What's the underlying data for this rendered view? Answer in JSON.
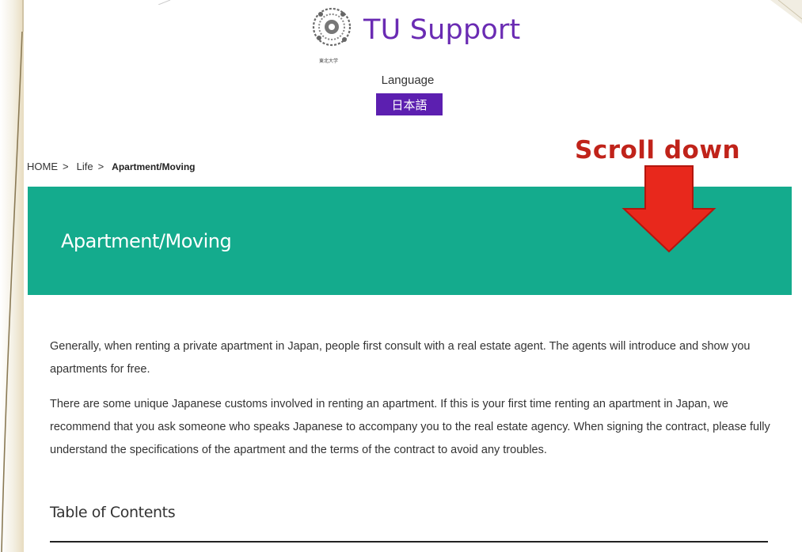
{
  "header": {
    "site_title": "TU Support",
    "logo_caption": "東北大学",
    "language_label": "Language",
    "language_button": "日本語"
  },
  "breadcrumb": {
    "items": [
      "HOME",
      "Life"
    ],
    "separator": ">",
    "current": "Apartment/Moving"
  },
  "annotation": {
    "text": "Scroll down",
    "icon": "arrow-down-icon",
    "color": "#c0231a"
  },
  "hero": {
    "title": "Apartment/Moving",
    "background": "#14ab8d"
  },
  "content": {
    "paragraphs": [
      "Generally, when renting a private apartment in Japan, people first consult with a real estate agent. The agents will introduce and show you apartments for free.",
      "There are some unique Japanese customs involved in renting an apartment. If this is your first time renting an apartment in Japan, we recommend that you ask someone who speaks Japanese to accompany you to the real estate agency. When signing the contract, please fully understand the specifications of the apartment and the terms of the contract to avoid any troubles."
    ],
    "toc_heading": "Table of Contents"
  },
  "colors": {
    "brand_purple": "#6a2bb3",
    "language_button_bg": "#5c1fb0",
    "hero_green": "#14ab8d"
  }
}
